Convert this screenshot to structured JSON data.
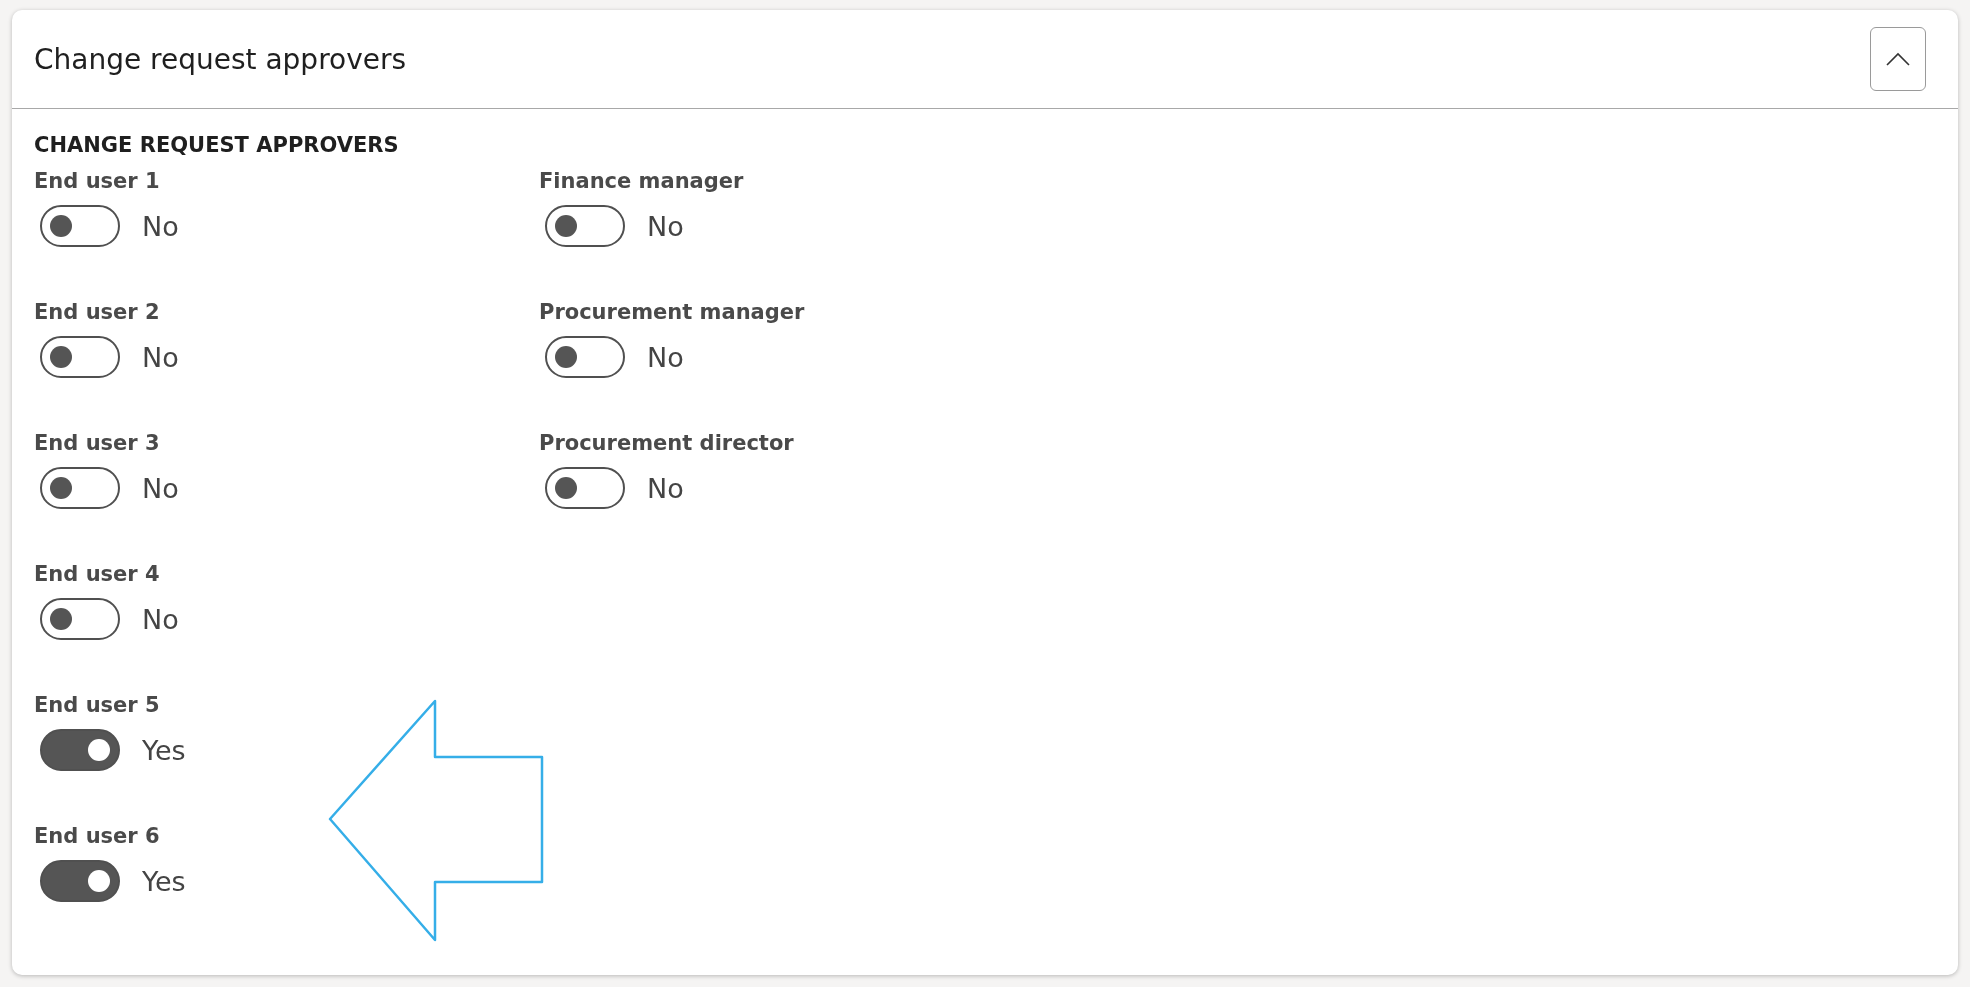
{
  "panel": {
    "title": "Change request approvers",
    "expanded": true
  },
  "section": {
    "heading": "CHANGE REQUEST APPROVERS"
  },
  "columns": [
    [
      {
        "label": "End user 1",
        "on": false,
        "value": "No"
      },
      {
        "label": "End user 2",
        "on": false,
        "value": "No"
      },
      {
        "label": "End user 3",
        "on": false,
        "value": "No"
      },
      {
        "label": "End user 4",
        "on": false,
        "value": "No"
      },
      {
        "label": "End user 5",
        "on": true,
        "value": "Yes"
      },
      {
        "label": "End user 6",
        "on": true,
        "value": "Yes"
      }
    ],
    [
      {
        "label": "Finance manager",
        "on": false,
        "value": "No"
      },
      {
        "label": "Procurement manager",
        "on": false,
        "value": "No"
      },
      {
        "label": "Procurement director",
        "on": false,
        "value": "No"
      }
    ]
  ]
}
